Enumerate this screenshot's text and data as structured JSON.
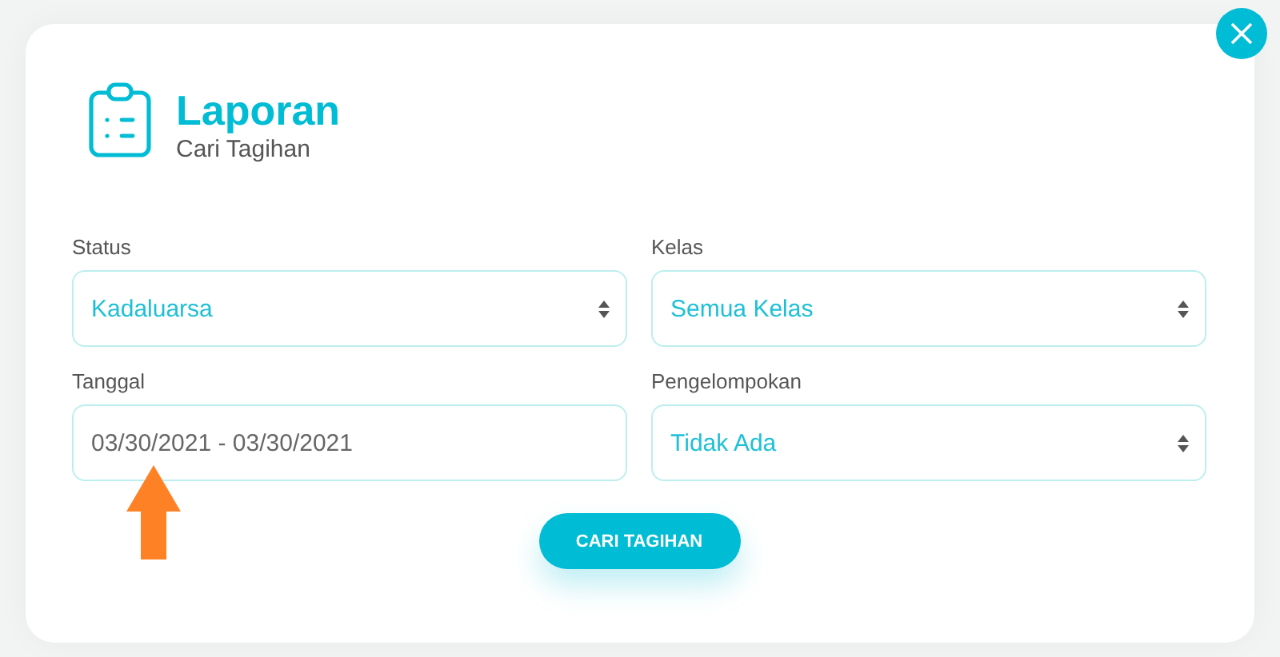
{
  "dialog": {
    "title": "Laporan",
    "subtitle": "Cari Tagihan"
  },
  "fields": [
    {
      "label": "Status",
      "kind": "select",
      "value": "Kadaluarsa"
    },
    {
      "label": "Kelas",
      "kind": "select",
      "value": "Semua Kelas"
    },
    {
      "label": "Tanggal",
      "kind": "date",
      "value": "03/30/2021 - 03/30/2021"
    },
    {
      "label": "Pengelompokan",
      "kind": "select",
      "value": "Tidak Ada"
    }
  ],
  "submit_button": "CARI TAGIHAN"
}
